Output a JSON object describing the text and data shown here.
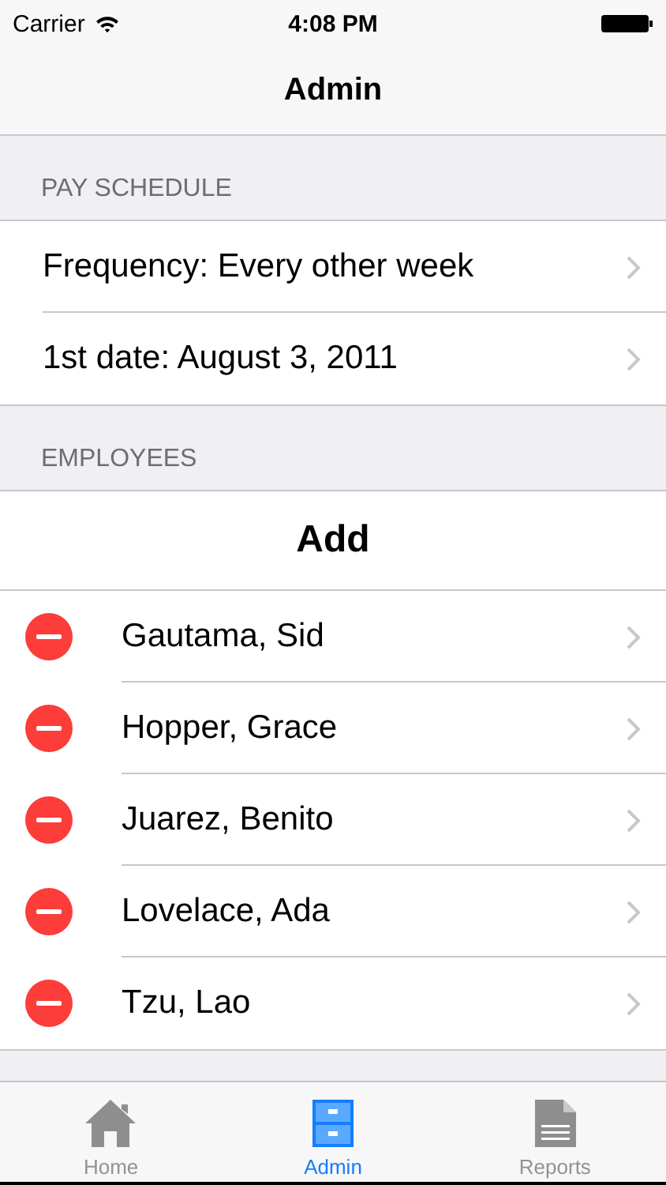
{
  "status_bar": {
    "carrier": "Carrier",
    "time": "4:08 PM"
  },
  "nav": {
    "title": "Admin"
  },
  "sections": [
    {
      "header": "PAY SCHEDULE",
      "rows": [
        {
          "label": "Frequency: Every other week"
        },
        {
          "label": "1st date: August 3, 2011"
        }
      ]
    },
    {
      "header": "EMPLOYEES",
      "add_label": "Add",
      "rows": [
        {
          "label": "Gautama, Sid",
          "deletable": true
        },
        {
          "label": "Hopper, Grace",
          "deletable": true
        },
        {
          "label": "Juarez, Benito",
          "deletable": true
        },
        {
          "label": "Lovelace, Ada",
          "deletable": true
        },
        {
          "label": "Tzu, Lao",
          "deletable": true
        }
      ]
    }
  ],
  "tabs": [
    {
      "label": "Home",
      "kind": "home",
      "selected": false
    },
    {
      "label": "Admin",
      "kind": "cabinet",
      "selected": true
    },
    {
      "label": "Reports",
      "kind": "document",
      "selected": false
    }
  ]
}
